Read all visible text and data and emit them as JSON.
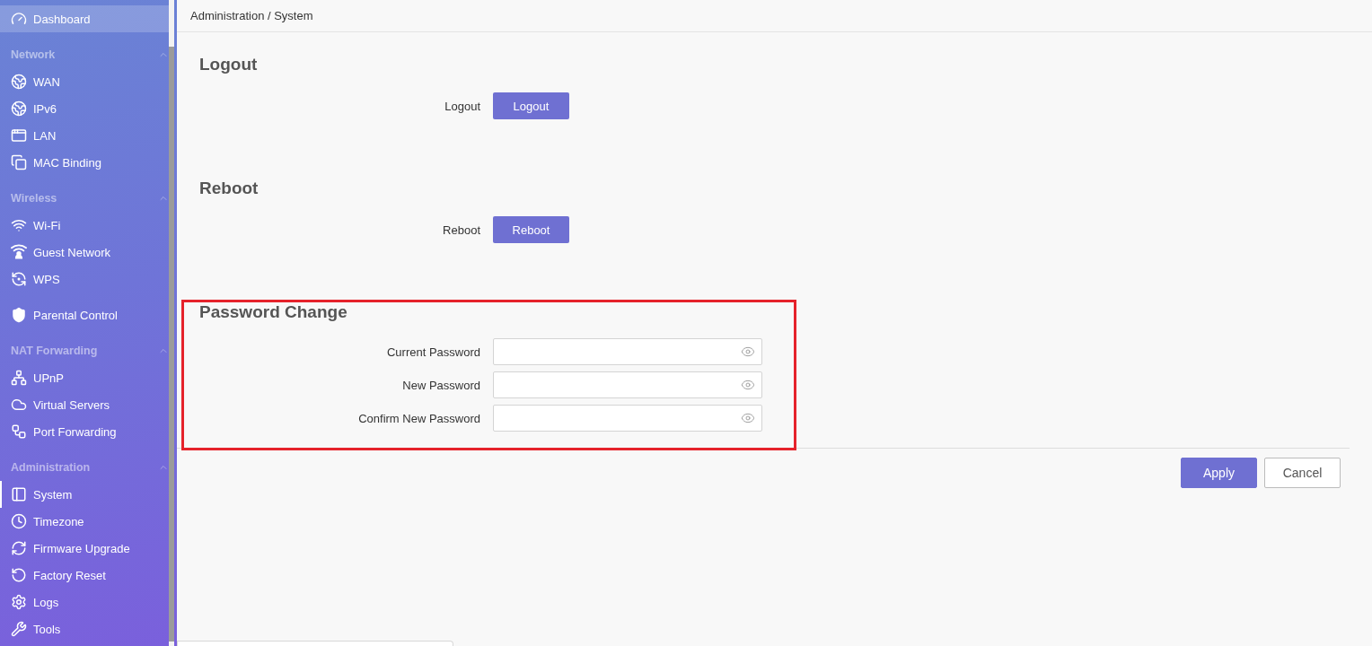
{
  "sidebar": {
    "items": [
      {
        "kind": "link",
        "label": "Dashboard",
        "selected": false,
        "highlighted": true
      },
      {
        "kind": "group",
        "label": "Network",
        "expanded": true,
        "children": [
          {
            "label": "WAN",
            "selected": false,
            "highlighted": false
          },
          {
            "label": "IPv6",
            "selected": false,
            "highlighted": false
          },
          {
            "label": "LAN",
            "selected": false,
            "highlighted": false
          },
          {
            "label": "MAC Binding",
            "selected": false,
            "highlighted": false
          }
        ]
      },
      {
        "kind": "group",
        "label": "Wireless",
        "expanded": true,
        "children": [
          {
            "label": "Wi-Fi",
            "selected": false,
            "highlighted": false
          },
          {
            "label": "Guest Network",
            "selected": false,
            "highlighted": false
          },
          {
            "label": "WPS",
            "selected": false,
            "highlighted": false
          }
        ]
      },
      {
        "kind": "link",
        "label": "Parental Control",
        "selected": false,
        "highlighted": false
      },
      {
        "kind": "group",
        "label": "NAT Forwarding",
        "expanded": true,
        "children": [
          {
            "label": "UPnP",
            "selected": false,
            "highlighted": false
          },
          {
            "label": "Virtual Servers",
            "selected": false,
            "highlighted": false
          },
          {
            "label": "Port Forwarding",
            "selected": false,
            "highlighted": false
          }
        ]
      },
      {
        "kind": "group",
        "label": "Administration",
        "expanded": true,
        "children": [
          {
            "label": "System",
            "selected": true,
            "highlighted": false
          },
          {
            "label": "Timezone",
            "selected": false,
            "highlighted": false
          },
          {
            "label": "Firmware Upgrade",
            "selected": false,
            "highlighted": false
          },
          {
            "label": "Factory Reset",
            "selected": false,
            "highlighted": false
          },
          {
            "label": "Logs",
            "selected": false,
            "highlighted": false
          },
          {
            "label": "Tools",
            "selected": false,
            "highlighted": false
          }
        ]
      }
    ]
  },
  "breadcrumb": "Administration / System",
  "sections": [
    {
      "kind": "action",
      "title": "Logout",
      "highlighted": false,
      "rows": [
        {
          "label": "Logout",
          "button": "Logout"
        }
      ]
    },
    {
      "kind": "action",
      "title": "Reboot",
      "highlighted": false,
      "rows": [
        {
          "label": "Reboot",
          "button": "Reboot"
        }
      ]
    },
    {
      "kind": "form",
      "title": "Password Change",
      "highlighted": true,
      "fields": [
        {
          "label": "Current Password"
        },
        {
          "label": "New Password"
        },
        {
          "label": "Confirm New Password"
        }
      ]
    }
  ],
  "footer": {
    "buttons": [
      {
        "kind": "primary",
        "label": "Apply"
      },
      {
        "kind": "secondary",
        "label": "Cancel"
      }
    ]
  }
}
